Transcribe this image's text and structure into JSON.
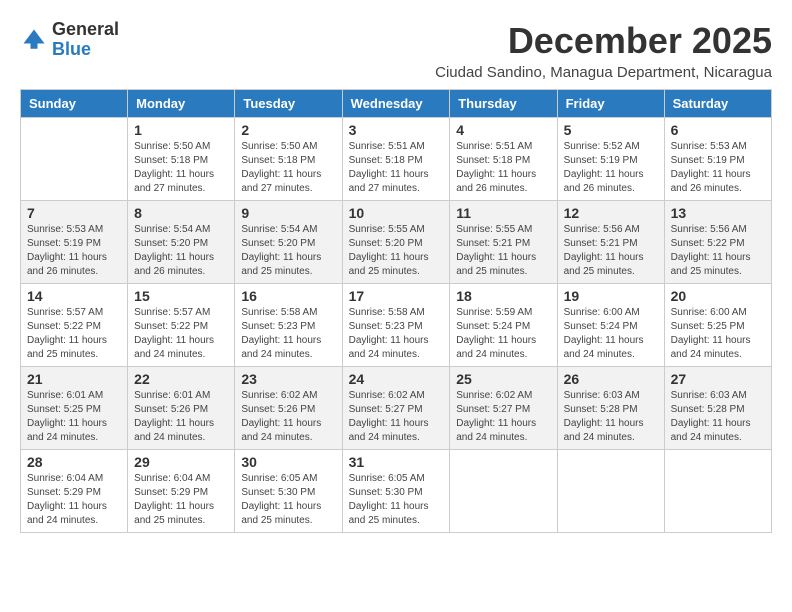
{
  "logo": {
    "general": "General",
    "blue": "Blue"
  },
  "header": {
    "month": "December 2025",
    "location": "Ciudad Sandino, Managua Department, Nicaragua"
  },
  "weekdays": [
    "Sunday",
    "Monday",
    "Tuesday",
    "Wednesday",
    "Thursday",
    "Friday",
    "Saturday"
  ],
  "weeks": [
    [
      {
        "day": "",
        "info": ""
      },
      {
        "day": "1",
        "info": "Sunrise: 5:50 AM\nSunset: 5:18 PM\nDaylight: 11 hours\nand 27 minutes."
      },
      {
        "day": "2",
        "info": "Sunrise: 5:50 AM\nSunset: 5:18 PM\nDaylight: 11 hours\nand 27 minutes."
      },
      {
        "day": "3",
        "info": "Sunrise: 5:51 AM\nSunset: 5:18 PM\nDaylight: 11 hours\nand 27 minutes."
      },
      {
        "day": "4",
        "info": "Sunrise: 5:51 AM\nSunset: 5:18 PM\nDaylight: 11 hours\nand 26 minutes."
      },
      {
        "day": "5",
        "info": "Sunrise: 5:52 AM\nSunset: 5:19 PM\nDaylight: 11 hours\nand 26 minutes."
      },
      {
        "day": "6",
        "info": "Sunrise: 5:53 AM\nSunset: 5:19 PM\nDaylight: 11 hours\nand 26 minutes."
      }
    ],
    [
      {
        "day": "7",
        "info": "Sunrise: 5:53 AM\nSunset: 5:19 PM\nDaylight: 11 hours\nand 26 minutes."
      },
      {
        "day": "8",
        "info": "Sunrise: 5:54 AM\nSunset: 5:20 PM\nDaylight: 11 hours\nand 26 minutes."
      },
      {
        "day": "9",
        "info": "Sunrise: 5:54 AM\nSunset: 5:20 PM\nDaylight: 11 hours\nand 25 minutes."
      },
      {
        "day": "10",
        "info": "Sunrise: 5:55 AM\nSunset: 5:20 PM\nDaylight: 11 hours\nand 25 minutes."
      },
      {
        "day": "11",
        "info": "Sunrise: 5:55 AM\nSunset: 5:21 PM\nDaylight: 11 hours\nand 25 minutes."
      },
      {
        "day": "12",
        "info": "Sunrise: 5:56 AM\nSunset: 5:21 PM\nDaylight: 11 hours\nand 25 minutes."
      },
      {
        "day": "13",
        "info": "Sunrise: 5:56 AM\nSunset: 5:22 PM\nDaylight: 11 hours\nand 25 minutes."
      }
    ],
    [
      {
        "day": "14",
        "info": "Sunrise: 5:57 AM\nSunset: 5:22 PM\nDaylight: 11 hours\nand 25 minutes."
      },
      {
        "day": "15",
        "info": "Sunrise: 5:57 AM\nSunset: 5:22 PM\nDaylight: 11 hours\nand 24 minutes."
      },
      {
        "day": "16",
        "info": "Sunrise: 5:58 AM\nSunset: 5:23 PM\nDaylight: 11 hours\nand 24 minutes."
      },
      {
        "day": "17",
        "info": "Sunrise: 5:58 AM\nSunset: 5:23 PM\nDaylight: 11 hours\nand 24 minutes."
      },
      {
        "day": "18",
        "info": "Sunrise: 5:59 AM\nSunset: 5:24 PM\nDaylight: 11 hours\nand 24 minutes."
      },
      {
        "day": "19",
        "info": "Sunrise: 6:00 AM\nSunset: 5:24 PM\nDaylight: 11 hours\nand 24 minutes."
      },
      {
        "day": "20",
        "info": "Sunrise: 6:00 AM\nSunset: 5:25 PM\nDaylight: 11 hours\nand 24 minutes."
      }
    ],
    [
      {
        "day": "21",
        "info": "Sunrise: 6:01 AM\nSunset: 5:25 PM\nDaylight: 11 hours\nand 24 minutes."
      },
      {
        "day": "22",
        "info": "Sunrise: 6:01 AM\nSunset: 5:26 PM\nDaylight: 11 hours\nand 24 minutes."
      },
      {
        "day": "23",
        "info": "Sunrise: 6:02 AM\nSunset: 5:26 PM\nDaylight: 11 hours\nand 24 minutes."
      },
      {
        "day": "24",
        "info": "Sunrise: 6:02 AM\nSunset: 5:27 PM\nDaylight: 11 hours\nand 24 minutes."
      },
      {
        "day": "25",
        "info": "Sunrise: 6:02 AM\nSunset: 5:27 PM\nDaylight: 11 hours\nand 24 minutes."
      },
      {
        "day": "26",
        "info": "Sunrise: 6:03 AM\nSunset: 5:28 PM\nDaylight: 11 hours\nand 24 minutes."
      },
      {
        "day": "27",
        "info": "Sunrise: 6:03 AM\nSunset: 5:28 PM\nDaylight: 11 hours\nand 24 minutes."
      }
    ],
    [
      {
        "day": "28",
        "info": "Sunrise: 6:04 AM\nSunset: 5:29 PM\nDaylight: 11 hours\nand 24 minutes."
      },
      {
        "day": "29",
        "info": "Sunrise: 6:04 AM\nSunset: 5:29 PM\nDaylight: 11 hours\nand 25 minutes."
      },
      {
        "day": "30",
        "info": "Sunrise: 6:05 AM\nSunset: 5:30 PM\nDaylight: 11 hours\nand 25 minutes."
      },
      {
        "day": "31",
        "info": "Sunrise: 6:05 AM\nSunset: 5:30 PM\nDaylight: 11 hours\nand 25 minutes."
      },
      {
        "day": "",
        "info": ""
      },
      {
        "day": "",
        "info": ""
      },
      {
        "day": "",
        "info": ""
      }
    ]
  ]
}
